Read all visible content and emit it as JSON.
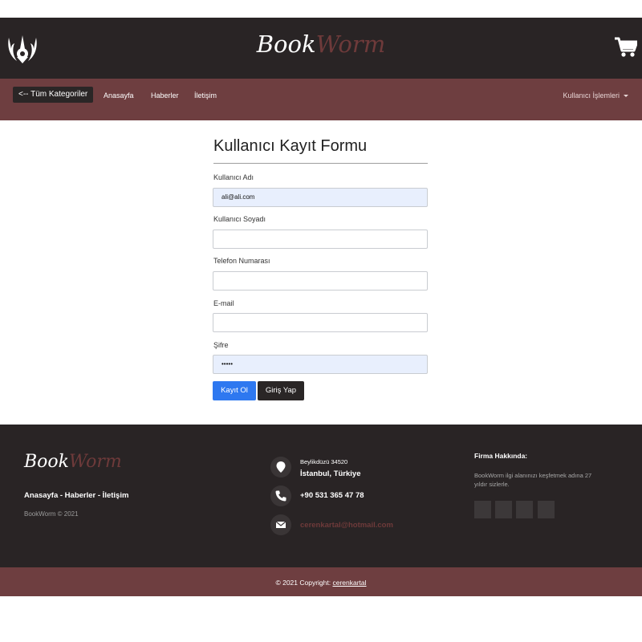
{
  "header": {
    "brand_part1": "Book",
    "brand_part2": "Worm",
    "logo_icon": "jedi-order-emblem-icon",
    "cart_icon": "shopping-cart-icon"
  },
  "navbar": {
    "categories_button": "<-- Tüm Kategoriler",
    "links": [
      "Anasayfa",
      "Haberler",
      "İletişim"
    ],
    "user_menu": "Kullanıcı İşlemleri"
  },
  "form": {
    "title": "Kullanıcı Kayıt Formu",
    "fields": [
      {
        "label": "Kullanıcı Adı",
        "value": "ali@ali.com"
      },
      {
        "label": "Kullanıcı Soyadı",
        "value": ""
      },
      {
        "label": "Telefon Numarası",
        "value": ""
      },
      {
        "label": "E-mail",
        "value": ""
      },
      {
        "label": "Şifre",
        "value": "•••••"
      }
    ],
    "register_button": "Kayıt Ol",
    "login_button": "Giriş Yap"
  },
  "footer": {
    "brand_part1": "Book",
    "brand_part2": "Worm",
    "links": "Anasayfa - Haberler - İletişim",
    "copyright": "BookWorm © 2021",
    "address_line1": "Beylikdüzü 34520",
    "address_line2": "İstanbul, Türkiye",
    "phone": "+90 531 365 47 78",
    "email": "cerenkartal@hotmail.com",
    "about_title": "Firma Hakkında:",
    "about_text": "BookWorm ilgi alanınızı keşfetmek adına 27 yıldır sizlerle."
  },
  "bottom": {
    "copyright_prefix": "© 2021 Copyright: ",
    "owner": "cerenkartal"
  },
  "colors": {
    "dark": "#292425",
    "maroon": "#6e3e40",
    "primary_button": "#2e78f0",
    "autofill": "#e8effd"
  }
}
